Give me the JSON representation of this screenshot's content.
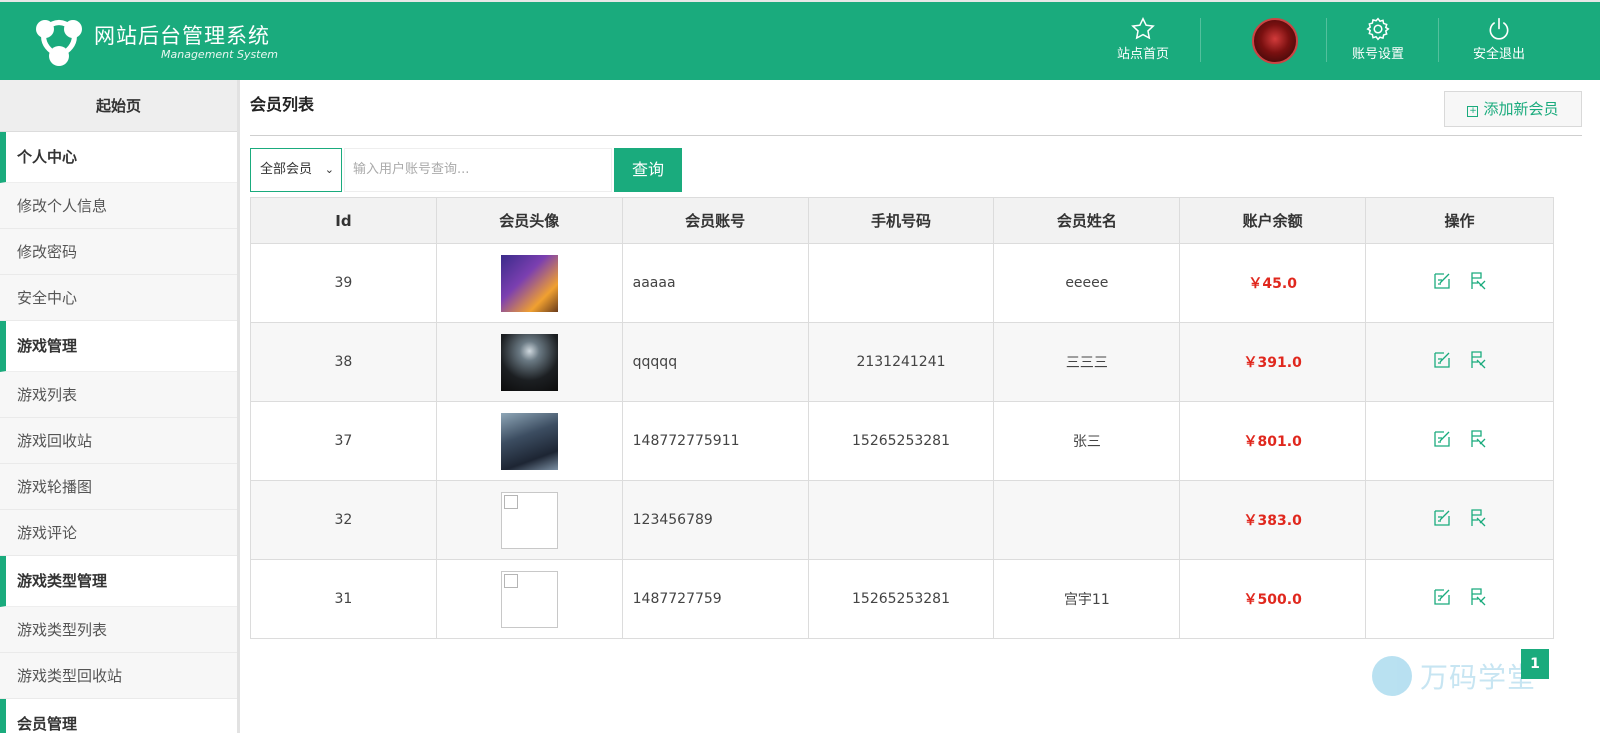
{
  "header": {
    "title": "网站后台管理系统",
    "subtitle": "Management System",
    "nav": [
      {
        "label": "站点首页",
        "icon": "star-icon"
      },
      {
        "label": "账号设置",
        "icon": "gear-icon"
      },
      {
        "label": "安全退出",
        "icon": "power-icon"
      }
    ],
    "accent": "#1aab7d"
  },
  "sidebar": {
    "home": "起始页",
    "groups": [
      {
        "title": "个人中心",
        "items": [
          "修改个人信息",
          "修改密码",
          "安全中心"
        ]
      },
      {
        "title": "游戏管理",
        "items": [
          "游戏列表",
          "游戏回收站",
          "游戏轮播图",
          "游戏评论"
        ]
      },
      {
        "title": "游戏类型管理",
        "items": [
          "游戏类型列表",
          "游戏类型回收站"
        ]
      },
      {
        "title": "会员管理",
        "items": []
      }
    ]
  },
  "main": {
    "title": "会员列表",
    "add_button": "添加新会员",
    "filter": {
      "selected": "全部会员"
    },
    "search": {
      "placeholder": "输入用户账号查询..."
    },
    "query_button": "查询",
    "table": {
      "columns": [
        "Id",
        "会员头像",
        "会员账号",
        "手机号码",
        "会员姓名",
        "账户余额",
        "操作"
      ],
      "rows": [
        {
          "id": "39",
          "account": "aaaaa",
          "phone": "",
          "name": "eeeee",
          "balance": "￥45.0"
        },
        {
          "id": "38",
          "account": "qqqqq",
          "phone": "2131241241",
          "name": "三三三",
          "balance": "￥391.0"
        },
        {
          "id": "37",
          "account": "148772775911",
          "phone": "15265253281",
          "name": "张三",
          "balance": "￥801.0"
        },
        {
          "id": "32",
          "account": "123456789",
          "phone": "",
          "name": "",
          "balance": "￥383.0"
        },
        {
          "id": "31",
          "account": "1487727759",
          "phone": "15265253281",
          "name": "宫宇11",
          "balance": "￥500.0"
        }
      ]
    },
    "pagination": {
      "current": "1"
    }
  },
  "watermark": {
    "text": "万码学堂"
  }
}
